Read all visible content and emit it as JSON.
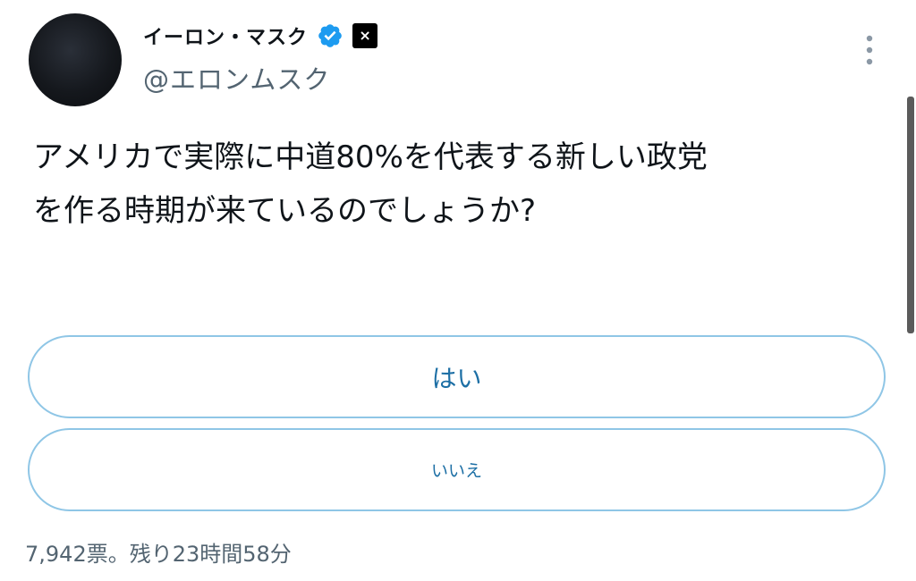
{
  "author": {
    "display_name": "イーロン・マスク",
    "handle": "@エロンムスク",
    "x_badge_label": "×",
    "verified_color": "#1d9bf0"
  },
  "tweet": {
    "text_line1": "アメリカで実際に中道80%を代表する新しい政党",
    "text_line2": "を作る時期が来ているのでしょうか?"
  },
  "poll": {
    "options": [
      {
        "label": "はい"
      },
      {
        "label": "いいえ"
      }
    ],
    "footer": "7,942票。残り23時間58分"
  },
  "icons": {
    "more": "more-vertical-icon",
    "verified": "verified-badge-icon"
  }
}
